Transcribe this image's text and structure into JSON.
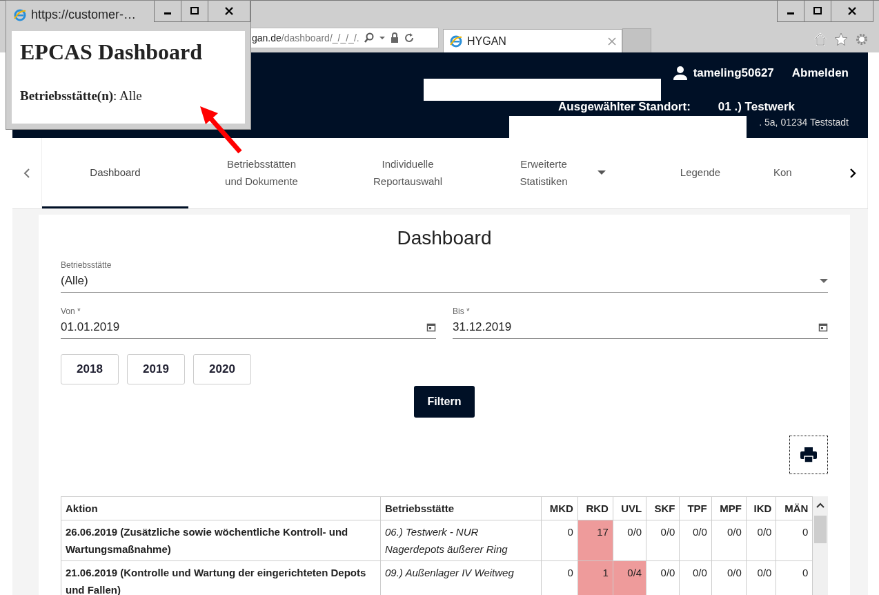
{
  "popup": {
    "title": "https://customer-…",
    "heading": "EPCAS Dashboard",
    "filter": "**Betriebsstätte(n)**: Alle"
  },
  "address_bar": {
    "host": "gan.de",
    "path": "/dashboard/_/_/_/."
  },
  "browser_tabs": [
    {
      "title": "HYGAN",
      "selected": true
    }
  ],
  "header": {
    "username": "tameling50627",
    "logout": "Abmelden",
    "location_label": "Ausgewählter Standort:",
    "location_name": "01 .) Testwerk",
    "location_address": ". 5a, 01234 Teststadt"
  },
  "nav": {
    "tabs": [
      {
        "label": "Dashboard",
        "selected": true,
        "dropdown": false
      },
      {
        "label": "Betriebsstätten und Dokumente",
        "selected": false,
        "dropdown": false
      },
      {
        "label": "Individuelle Reportauswahl",
        "selected": false,
        "dropdown": false
      },
      {
        "label": "Erweiterte Statistiken",
        "selected": false,
        "dropdown": true
      },
      {
        "label": "Legende",
        "selected": false,
        "dropdown": false
      },
      {
        "label": "Kon",
        "selected": false,
        "dropdown": false
      }
    ]
  },
  "form": {
    "title": "Dashboard",
    "site": {
      "label": "Betriebsstätte",
      "value": "(Alle)"
    },
    "from": {
      "label": "Von *",
      "value": "01.01.2019"
    },
    "to": {
      "label": "Bis *",
      "value": "31.12.2019"
    },
    "years": [
      "2018",
      "2019",
      "2020"
    ],
    "filter_button": "Filtern"
  },
  "table": {
    "columns": [
      "Aktion",
      "Betriebsstätte",
      "MKD",
      "RKD",
      "UVL",
      "SKF",
      "TPF",
      "MPF",
      "IKD",
      "MÄN"
    ],
    "rows": [
      {
        "cells": [
          {
            "value": "26.06.2019 (Zusätzliche sowie wöchentliche Kontroll- und Wartungsmaßnahme)",
            "alert": false
          },
          {
            "value": "06.) Testwerk - NUR Nagerdepots äußerer Ring",
            "alert": false
          },
          {
            "value": "0",
            "alert": false
          },
          {
            "value": "17",
            "alert": true
          },
          {
            "value": "0/0",
            "alert": false
          },
          {
            "value": "0/0",
            "alert": false
          },
          {
            "value": "0/0",
            "alert": false
          },
          {
            "value": "0/0",
            "alert": false
          },
          {
            "value": "0/0",
            "alert": false
          },
          {
            "value": "0",
            "alert": false
          }
        ]
      },
      {
        "cells": [
          {
            "value": "21.06.2019 (Kontrolle und Wartung der eingerichteten Depots und Fallen)",
            "alert": false
          },
          {
            "value": "09.) Außenlager IV Weitweg",
            "alert": false
          },
          {
            "value": "0",
            "alert": false
          },
          {
            "value": "1",
            "alert": true
          },
          {
            "value": "0/4",
            "alert": true
          },
          {
            "value": "0/0",
            "alert": false
          },
          {
            "value": "0/0",
            "alert": false
          },
          {
            "value": "0/0",
            "alert": false
          },
          {
            "value": "0/0",
            "alert": false
          },
          {
            "value": "0",
            "alert": false
          }
        ]
      }
    ]
  }
}
